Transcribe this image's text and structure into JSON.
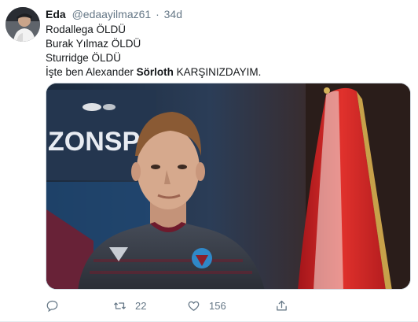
{
  "tweet": {
    "display_name": "Eda",
    "handle": "@edaayilmaz61",
    "separator": "·",
    "time": "34d",
    "lines": [
      "Rodallega ÖLDÜ",
      "Burak Yılmaz ÖLDÜ",
      "Sturridge ÖLDÜ"
    ],
    "last_line": {
      "before": "İşte ben Alexander ",
      "bold": "Sörloth",
      "after": " KARŞINIZDAYIM."
    }
  },
  "actions": {
    "reply": {
      "icon": "reply-icon",
      "count": ""
    },
    "retweet": {
      "icon": "retweet-icon",
      "count": "22"
    },
    "like": {
      "icon": "heart-icon",
      "count": "156"
    },
    "share": {
      "icon": "share-icon",
      "count": ""
    }
  },
  "media": {
    "description_icon": "photo",
    "backdrop_text": "ZONSP"
  },
  "colors": {
    "text": "#14171a",
    "secondary": "#657786",
    "flag_red": "#d42b27",
    "jersey": "#3a3f4a"
  }
}
